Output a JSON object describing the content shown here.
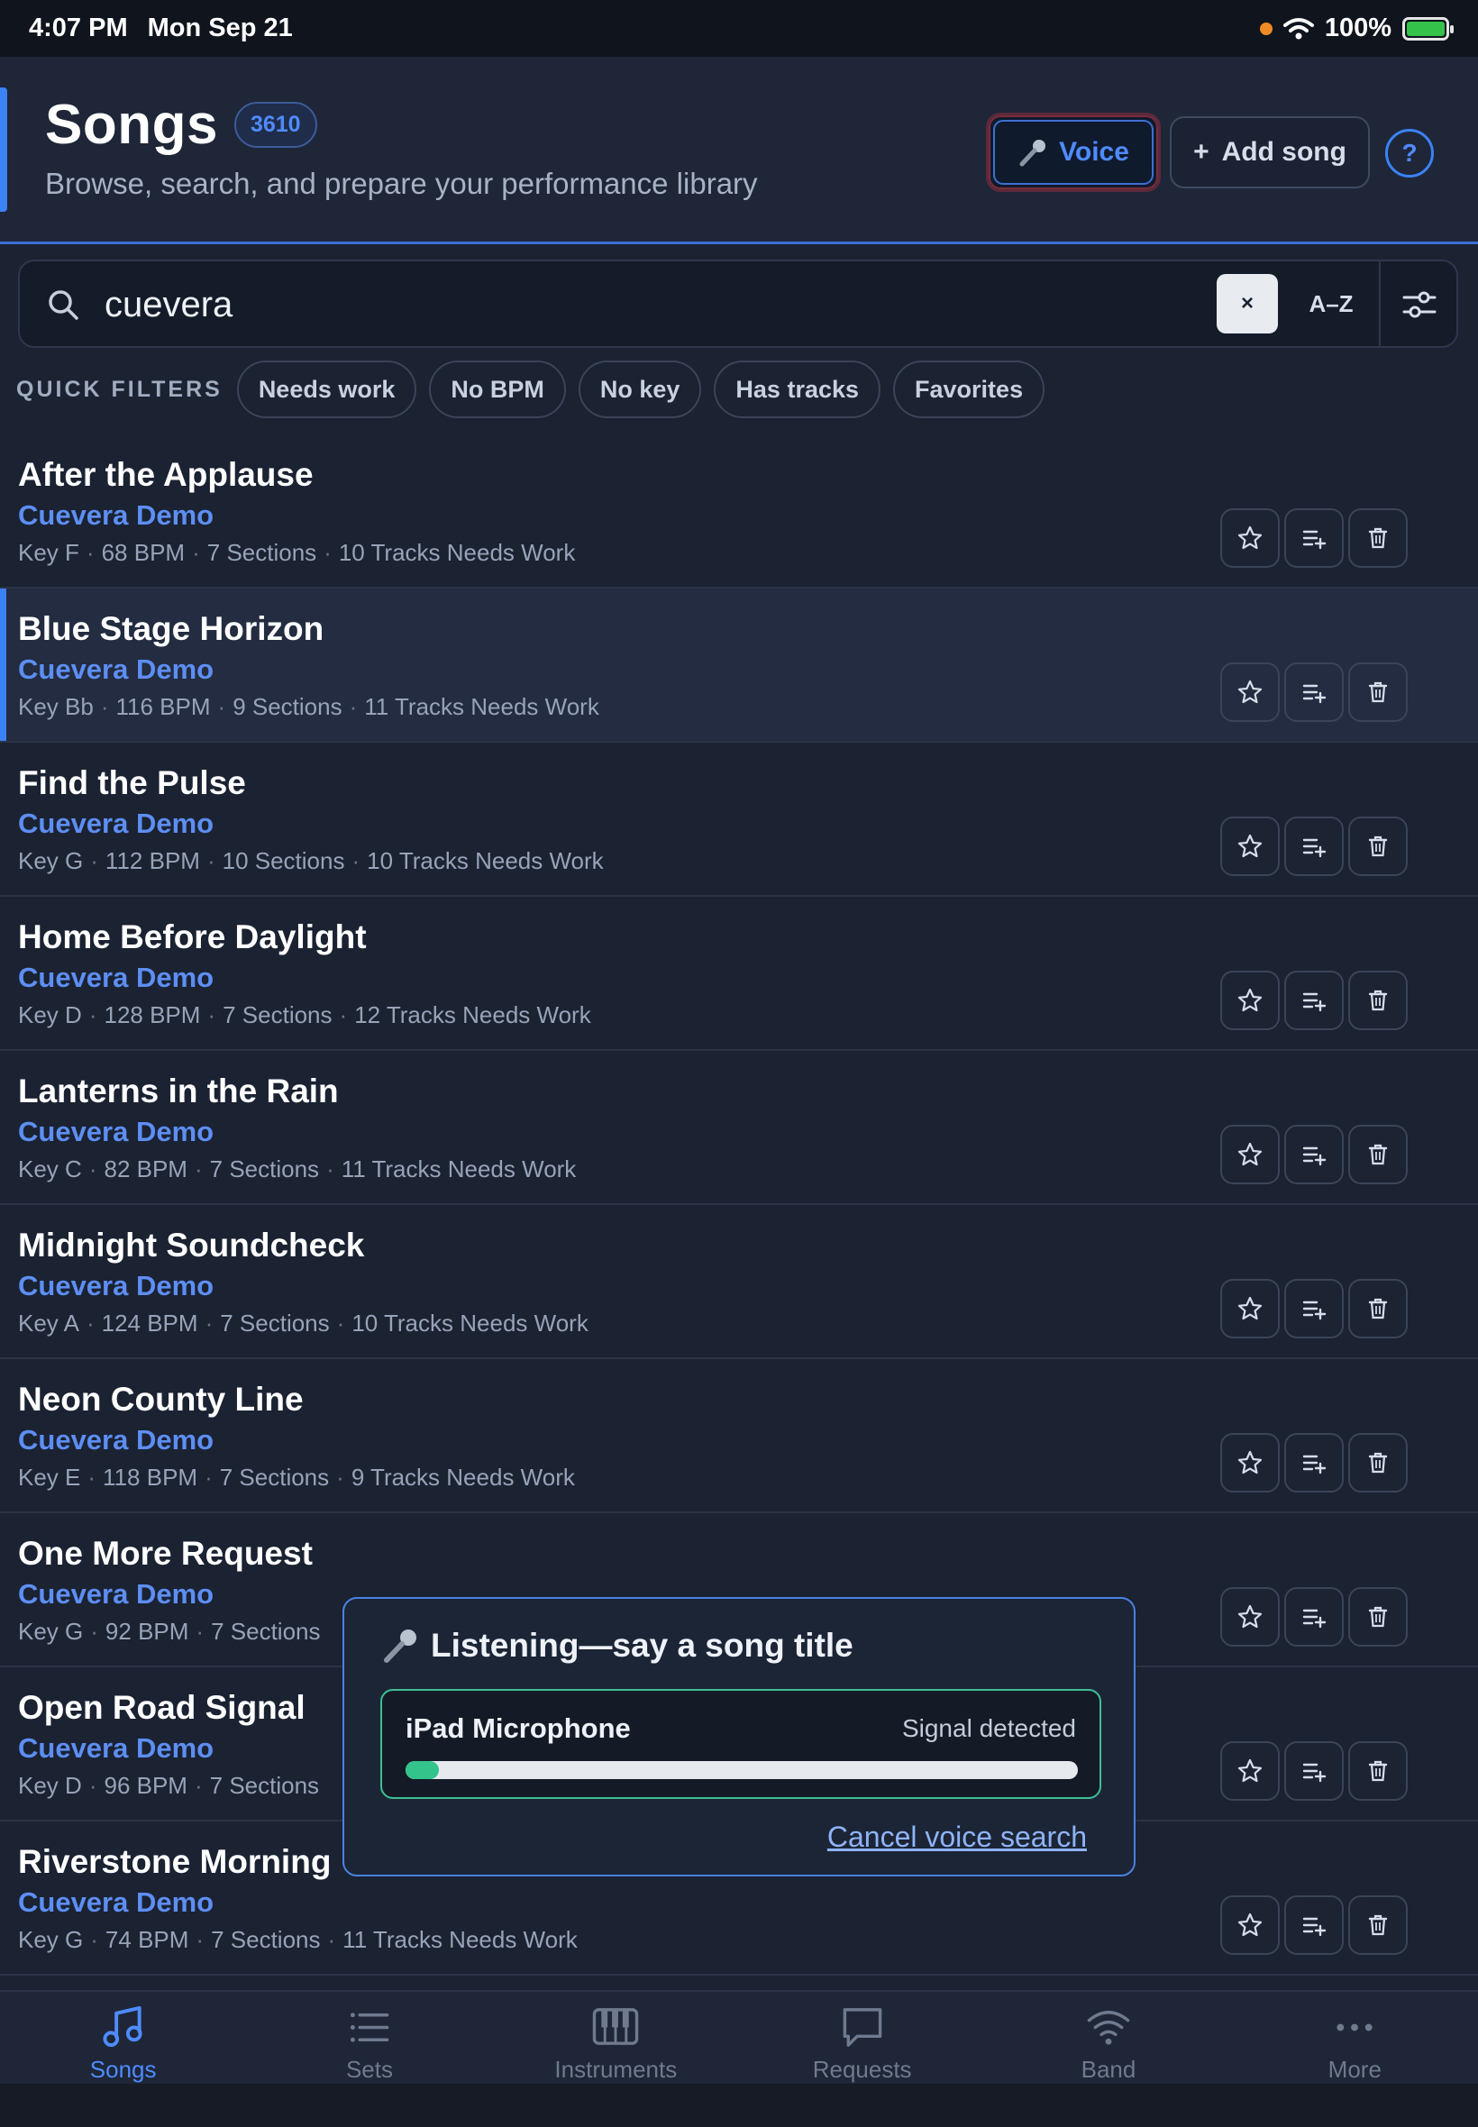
{
  "status_bar": {
    "time": "4:07 PM",
    "date": "Mon Sep 21",
    "battery": "100%"
  },
  "header": {
    "title": "Songs",
    "count": "3610",
    "subtitle": "Browse, search, and prepare your performance library",
    "voice_label": "Voice",
    "add_label": "Add song",
    "help_label": "?"
  },
  "search": {
    "value": "cuevera",
    "clear_label": "×",
    "sort_label": "A–Z"
  },
  "quick_filters": {
    "label": "QUICK FILTERS",
    "chips": [
      "Needs work",
      "No BPM",
      "No key",
      "Has tracks",
      "Favorites"
    ]
  },
  "songs": [
    {
      "title": "After the Applause",
      "artist": "Cuevera Demo",
      "key": "Key F",
      "bpm": "68 BPM",
      "sections": "7 Sections",
      "tracks": "10 Tracks Needs Work"
    },
    {
      "title": "Blue Stage Horizon",
      "artist": "Cuevera Demo",
      "key": "Key Bb",
      "bpm": "116 BPM",
      "sections": "9 Sections",
      "tracks": "11 Tracks Needs Work"
    },
    {
      "title": "Find the Pulse",
      "artist": "Cuevera Demo",
      "key": "Key G",
      "bpm": "112 BPM",
      "sections": "10 Sections",
      "tracks": "10 Tracks Needs Work"
    },
    {
      "title": "Home Before Daylight",
      "artist": "Cuevera Demo",
      "key": "Key D",
      "bpm": "128 BPM",
      "sections": "7 Sections",
      "tracks": "12 Tracks Needs Work"
    },
    {
      "title": "Lanterns in the Rain",
      "artist": "Cuevera Demo",
      "key": "Key C",
      "bpm": "82 BPM",
      "sections": "7 Sections",
      "tracks": "11 Tracks Needs Work"
    },
    {
      "title": "Midnight Soundcheck",
      "artist": "Cuevera Demo",
      "key": "Key A",
      "bpm": "124 BPM",
      "sections": "7 Sections",
      "tracks": "10 Tracks Needs Work"
    },
    {
      "title": "Neon County Line",
      "artist": "Cuevera Demo",
      "key": "Key E",
      "bpm": "118 BPM",
      "sections": "7 Sections",
      "tracks": "9 Tracks Needs Work"
    },
    {
      "title": "One More Request",
      "artist": "Cuevera Demo",
      "key": "Key G",
      "bpm": "92 BPM",
      "sections": "7 Sections",
      "tracks": ""
    },
    {
      "title": "Open Road Signal",
      "artist": "Cuevera Demo",
      "key": "Key D",
      "bpm": "96 BPM",
      "sections": "7 Sections",
      "tracks": ""
    },
    {
      "title": "Riverstone Morning",
      "artist": "Cuevera Demo",
      "key": "Key G",
      "bpm": "74 BPM",
      "sections": "7 Sections",
      "tracks": "11 Tracks Needs Work"
    }
  ],
  "voice_popup": {
    "title": "Listening—say a song title",
    "mic_name": "iPad Microphone",
    "mic_status": "Signal detected",
    "level_percent": 5,
    "cancel_label": "Cancel voice search"
  },
  "tabs": [
    {
      "label": "Songs",
      "icon": "music-note-icon",
      "active": true
    },
    {
      "label": "Sets",
      "icon": "list-icon",
      "active": false
    },
    {
      "label": "Instruments",
      "icon": "piano-keys-icon",
      "active": false
    },
    {
      "label": "Requests",
      "icon": "speech-bubble-icon",
      "active": false
    },
    {
      "label": "Band",
      "icon": "wifi-icon",
      "active": false
    },
    {
      "label": "More",
      "icon": "more-dots-icon",
      "active": false
    }
  ],
  "colors": {
    "accent": "#3b82f6",
    "success": "#33c48c",
    "background": "#1b2232"
  }
}
